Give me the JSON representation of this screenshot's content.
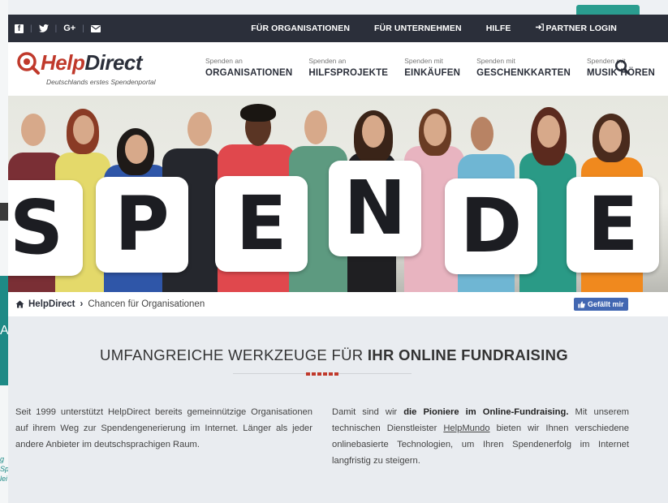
{
  "topbar": {
    "social": [
      "f",
      "twitter",
      "G+",
      "mail"
    ],
    "links": [
      "FÜR ORGANISATIONEN",
      "FÜR UNTERNEHMEN",
      "HILFE",
      "PARTNER LOGIN"
    ]
  },
  "logo": {
    "help": "Help",
    "direct": "Direct",
    "tagline": "Deutschlands erstes Spendenportal"
  },
  "nav": [
    {
      "small": "Spenden an",
      "big": "ORGANISATIONEN"
    },
    {
      "small": "Spenden an",
      "big": "HILFSPROJEKTE"
    },
    {
      "small": "Spenden mit",
      "big": "EINKÄUFEN"
    },
    {
      "small": "Spenden mit",
      "big": "GESCHENKKARTEN"
    },
    {
      "small": "Spenden mit",
      "big": "MUSIK HÖREN"
    }
  ],
  "hero": {
    "letters": [
      "S",
      "P",
      "E",
      "N",
      "D",
      "E"
    ]
  },
  "breadcrumb": {
    "home": "HelpDirect",
    "separator": "›",
    "current": "Chancen für Organisationen"
  },
  "like_button": "Gefällt mir",
  "section": {
    "title_light": "UMFANGREICHE WERKZEUGE FÜR ",
    "title_bold": "IHR ONLINE FUNDRAISING"
  },
  "left_text": "Seit 1999 unterstützt HelpDirect bereits gemeinnützige Organisationen auf ihrem Weg zur Spendengenerierung im Internet. Länger als jeder andere Anbieter im deutschsprachigen Raum.",
  "right_text": {
    "intro": "Damit sind wir ",
    "bold": "die Pioniere im Online-Fundraising.",
    "mid": " Mit unserem technischen Dienstleister ",
    "link": "HelpMundo",
    "end": " bieten wir Ihnen verschiedene onlinebasierte Technologien, um Ihren Spendenerfolg im Internet langfristig zu steigern."
  },
  "underlay": {
    "teal_letters": "AR",
    "small_text": "g Sp lei"
  },
  "colors": {
    "brand_red": "#c0392b",
    "dark": "#2b2f3a",
    "facebook": "#4267b2",
    "teal": "#2a9d8f"
  }
}
